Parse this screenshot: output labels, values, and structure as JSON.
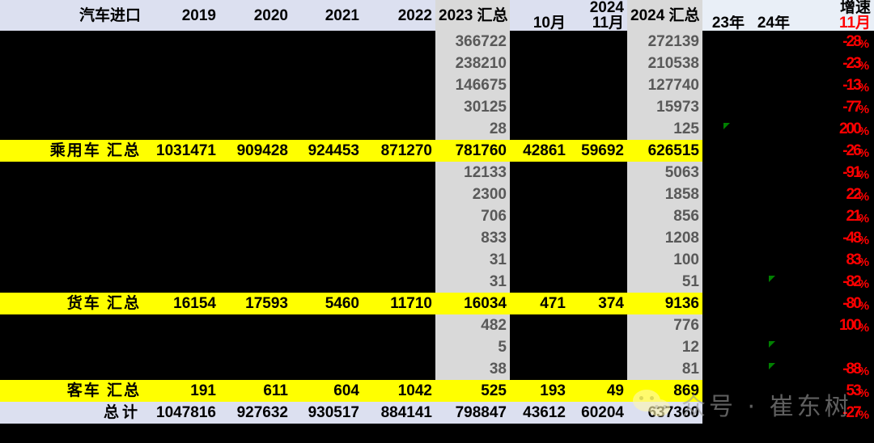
{
  "app": {
    "type": "spreadsheet-screenshot",
    "accent_yellow": "#ffff00",
    "accent_red": "#ff0000",
    "header_blue": "#dce0f0",
    "header_gray": "#d9d9d9"
  },
  "header": {
    "corner_label": "汽车进口",
    "year_columns": [
      "2019",
      "2020",
      "2021",
      "2022"
    ],
    "group_2023": "2023 汇总",
    "group_2024": "2024",
    "months_2024": [
      "10月",
      "11月"
    ],
    "group_2024_total": "2024 汇总",
    "growth_group": "增速",
    "growth_columns": [
      "23年",
      "24年",
      "11月"
    ]
  },
  "columns": [
    "汽车进口",
    "2019",
    "2020",
    "2021",
    "2022",
    "2023 汇总",
    "10月",
    "11月",
    "2024 汇总",
    "23年",
    "24年",
    "11月"
  ],
  "rows": [
    {
      "kind": "data",
      "label": "",
      "y2019": "",
      "y2020": "",
      "y2021": "",
      "y2022": "",
      "t2023": "366722",
      "m10": "",
      "m11": "",
      "t2024": "272139",
      "g23": "",
      "g24": "",
      "g11": "-28%",
      "marker23": false,
      "marker24": false
    },
    {
      "kind": "data",
      "label": "",
      "y2019": "",
      "y2020": "",
      "y2021": "",
      "y2022": "",
      "t2023": "238210",
      "m10": "",
      "m11": "",
      "t2024": "210538",
      "g23": "",
      "g24": "",
      "g11": "-23%",
      "marker23": false,
      "marker24": false
    },
    {
      "kind": "data",
      "label": "",
      "y2019": "",
      "y2020": "",
      "y2021": "",
      "y2022": "",
      "t2023": "146675",
      "m10": "",
      "m11": "",
      "t2024": "127740",
      "g23": "",
      "g24": "",
      "g11": "-13%",
      "marker23": false,
      "marker24": false
    },
    {
      "kind": "data",
      "label": "",
      "y2019": "",
      "y2020": "",
      "y2021": "",
      "y2022": "",
      "t2023": "30125",
      "m10": "",
      "m11": "",
      "t2024": "15973",
      "g23": "",
      "g24": "",
      "g11": "-77%",
      "marker23": false,
      "marker24": false
    },
    {
      "kind": "data",
      "label": "",
      "y2019": "",
      "y2020": "",
      "y2021": "",
      "y2022": "",
      "t2023": "28",
      "m10": "",
      "m11": "",
      "t2024": "125",
      "g23": "",
      "g24": "",
      "g11": "200%",
      "marker23": true,
      "marker24": false
    },
    {
      "kind": "sum",
      "label": "乘用车 汇总",
      "y2019": "1031471",
      "y2020": "909428",
      "y2021": "924453",
      "y2022": "871270",
      "t2023": "781760",
      "m10": "42861",
      "m11": "59692",
      "t2024": "626515",
      "g23": "",
      "g24": "",
      "g11": "-26%",
      "marker23": false,
      "marker24": false
    },
    {
      "kind": "data",
      "label": "",
      "y2019": "",
      "y2020": "",
      "y2021": "",
      "y2022": "",
      "t2023": "12133",
      "m10": "",
      "m11": "",
      "t2024": "5063",
      "g23": "",
      "g24": "",
      "g11": "-91%",
      "marker23": false,
      "marker24": false
    },
    {
      "kind": "data",
      "label": "",
      "y2019": "",
      "y2020": "",
      "y2021": "",
      "y2022": "",
      "t2023": "2300",
      "m10": "",
      "m11": "",
      "t2024": "1858",
      "g23": "",
      "g24": "",
      "g11": "22%",
      "marker23": false,
      "marker24": false
    },
    {
      "kind": "data",
      "label": "",
      "y2019": "",
      "y2020": "",
      "y2021": "",
      "y2022": "",
      "t2023": "706",
      "m10": "",
      "m11": "",
      "t2024": "856",
      "g23": "",
      "g24": "",
      "g11": "21%",
      "marker23": false,
      "marker24": false
    },
    {
      "kind": "data",
      "label": "",
      "y2019": "",
      "y2020": "",
      "y2021": "",
      "y2022": "",
      "t2023": "833",
      "m10": "",
      "m11": "",
      "t2024": "1208",
      "g23": "",
      "g24": "",
      "g11": "-48%",
      "marker23": false,
      "marker24": false
    },
    {
      "kind": "data",
      "label": "",
      "y2019": "",
      "y2020": "",
      "y2021": "",
      "y2022": "",
      "t2023": "31",
      "m10": "",
      "m11": "",
      "t2024": "100",
      "g23": "",
      "g24": "",
      "g11": "83%",
      "marker23": false,
      "marker24": false
    },
    {
      "kind": "data",
      "label": "",
      "y2019": "",
      "y2020": "",
      "y2021": "",
      "y2022": "",
      "t2023": "31",
      "m10": "",
      "m11": "",
      "t2024": "51",
      "g23": "",
      "g24": "",
      "g11": "-82%",
      "marker23": false,
      "marker24": true
    },
    {
      "kind": "sum",
      "label": "货车 汇总",
      "y2019": "16154",
      "y2020": "17593",
      "y2021": "5460",
      "y2022": "11710",
      "t2023": "16034",
      "m10": "471",
      "m11": "374",
      "t2024": "9136",
      "g23": "",
      "g24": "",
      "g11": "-80%",
      "marker23": false,
      "marker24": false
    },
    {
      "kind": "data",
      "label": "",
      "y2019": "",
      "y2020": "",
      "y2021": "",
      "y2022": "",
      "t2023": "482",
      "m10": "",
      "m11": "",
      "t2024": "776",
      "g23": "",
      "g24": "",
      "g11": "100%",
      "marker23": false,
      "marker24": false
    },
    {
      "kind": "data",
      "label": "",
      "y2019": "",
      "y2020": "",
      "y2021": "",
      "y2022": "",
      "t2023": "5",
      "m10": "",
      "m11": "",
      "t2024": "12",
      "g23": "",
      "g24": "",
      "g11": "",
      "marker23": false,
      "marker24": true
    },
    {
      "kind": "data",
      "label": "",
      "y2019": "",
      "y2020": "",
      "y2021": "",
      "y2022": "",
      "t2023": "38",
      "m10": "",
      "m11": "",
      "t2024": "81",
      "g23": "",
      "g24": "",
      "g11": "-88%",
      "marker23": false,
      "marker24": true
    },
    {
      "kind": "sum",
      "label": "客车 汇总",
      "y2019": "191",
      "y2020": "611",
      "y2021": "604",
      "y2022": "1042",
      "t2023": "525",
      "m10": "193",
      "m11": "49",
      "t2024": "869",
      "g23": "",
      "g24": "",
      "g11": "53%",
      "marker23": false,
      "marker24": false
    },
    {
      "kind": "total",
      "label": "总计",
      "y2019": "1047816",
      "y2020": "927632",
      "y2021": "930517",
      "y2022": "884141",
      "t2023": "798847",
      "m10": "43612",
      "m11": "60204",
      "t2024": "637360",
      "g23": "",
      "g24": "",
      "g11": "-27%",
      "marker23": false,
      "marker24": false
    }
  ],
  "watermark": {
    "text": "众号 · 崔东树",
    "logo": "wechat-logo"
  }
}
